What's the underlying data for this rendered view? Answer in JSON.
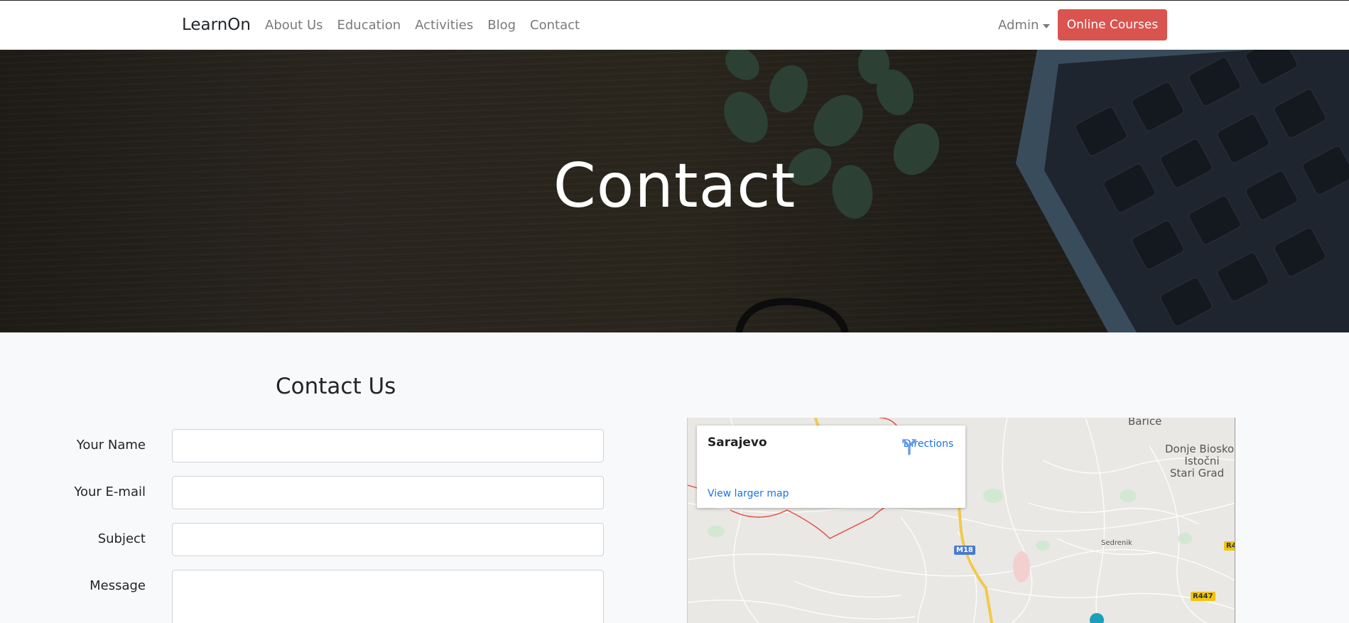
{
  "navbar": {
    "brand": "LearnOn",
    "links": [
      "About Us",
      "Education",
      "Activities",
      "Blog",
      "Contact"
    ],
    "admin_label": "Admin",
    "courses_button": "Online Courses"
  },
  "hero": {
    "title": "Contact"
  },
  "contact": {
    "title": "Contact Us",
    "fields": [
      {
        "label": "Your Name",
        "value": ""
      },
      {
        "label": "Your E-mail",
        "value": ""
      },
      {
        "label": "Subject",
        "value": ""
      },
      {
        "label": "Message",
        "value": ""
      }
    ]
  },
  "map": {
    "city": "Sarajevo",
    "directions": "Directions",
    "larger_map": "View larger map",
    "place_labels": [
      "Barice",
      "Donje Biosko,",
      "Istočni",
      "Stari Grad",
      "Sedrenik"
    ],
    "road_badges": [
      "M18",
      "R447",
      "R4"
    ],
    "colors": {
      "link": "#1a73e8",
      "road": "#f2c94c",
      "border": "#e74c3c",
      "badge_blue": "#4a7bd0",
      "badge_yellow": "#f1c40f"
    }
  }
}
